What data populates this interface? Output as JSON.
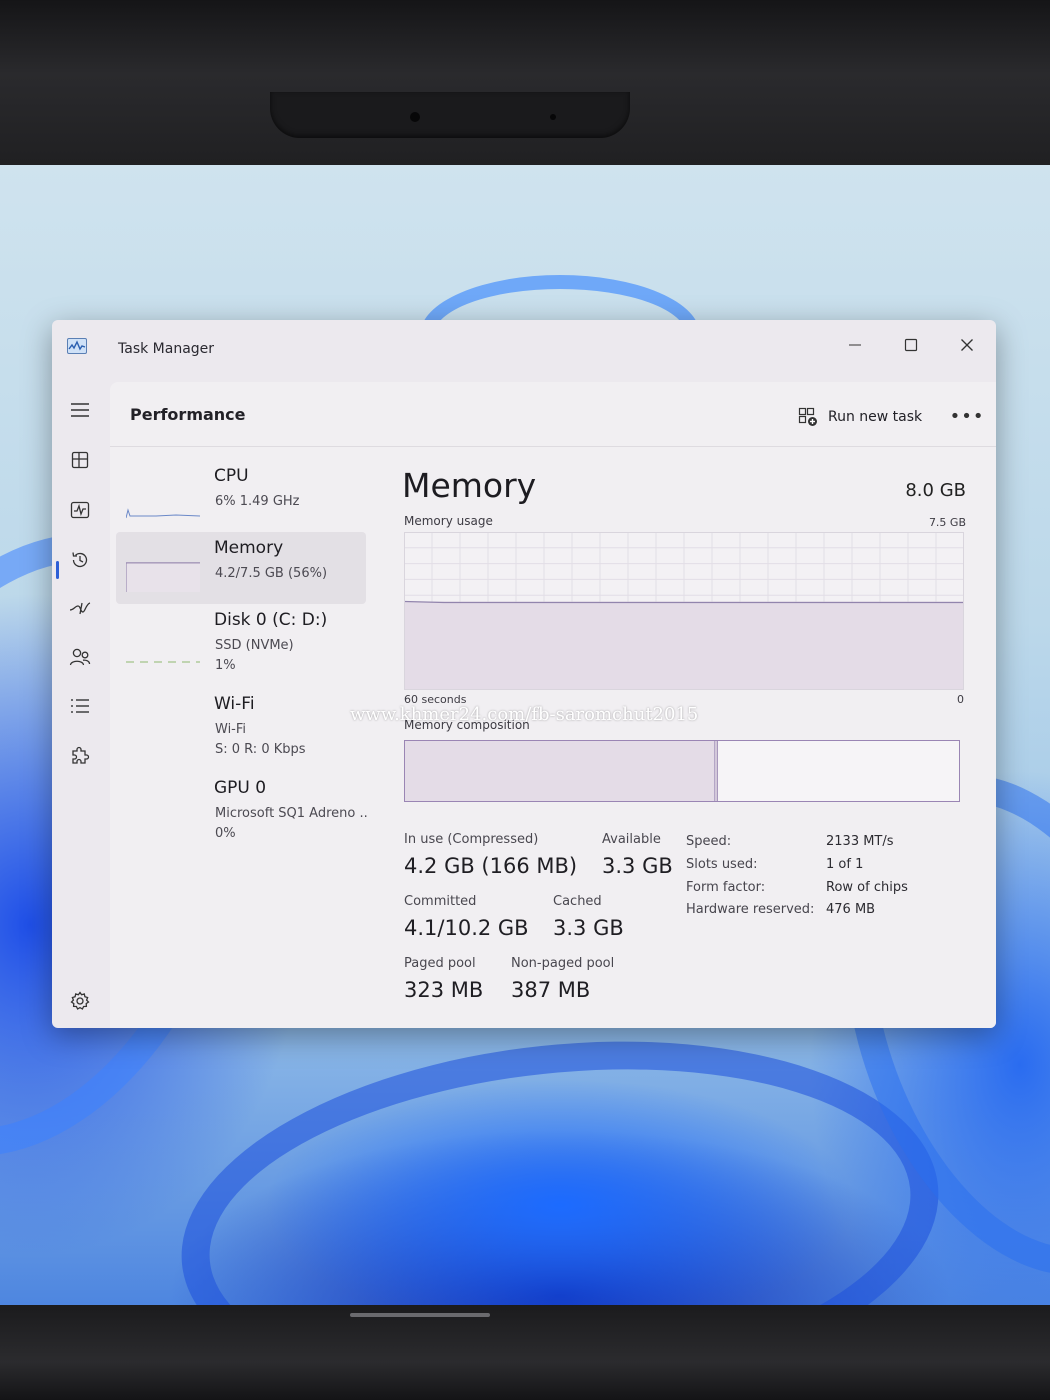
{
  "window": {
    "title": "Task Manager",
    "minimize_icon": "minimize-icon",
    "maximize_icon": "maximize-icon",
    "close_icon": "close-icon"
  },
  "sidebar": {
    "items": [
      {
        "name": "hamburger-menu",
        "icon": "hamburger-icon"
      },
      {
        "name": "processes",
        "icon": "processes-icon"
      },
      {
        "name": "performance",
        "icon": "performance-icon",
        "active": true
      },
      {
        "name": "app-history",
        "icon": "history-icon"
      },
      {
        "name": "startup-apps",
        "icon": "startup-icon"
      },
      {
        "name": "users",
        "icon": "users-icon"
      },
      {
        "name": "details",
        "icon": "list-icon"
      },
      {
        "name": "services",
        "icon": "puzzle-icon"
      },
      {
        "name": "settings",
        "icon": "gear-icon"
      }
    ]
  },
  "header": {
    "title": "Performance",
    "run_new_task": "Run new task",
    "more": "•••"
  },
  "devices": [
    {
      "name": "CPU",
      "line1": "6%  1.49 GHz",
      "line2": ""
    },
    {
      "name": "Memory",
      "line1": "4.2/7.5 GB (56%)",
      "line2": "",
      "selected": true
    },
    {
      "name": "Disk 0 (C: D:)",
      "line1": "SSD (NVMe)",
      "line2": "1%"
    },
    {
      "name": "Wi-Fi",
      "line1": "Wi-Fi",
      "line2": "S: 0 R: 0 Kbps"
    },
    {
      "name": "GPU 0",
      "line1": "Microsoft SQ1 Adreno ..",
      "line2": "0%"
    }
  ],
  "memory": {
    "title": "Memory",
    "total": "8.0 GB",
    "usage_label": "Memory usage",
    "usage_max": "7.5 GB",
    "axis_left": "60 seconds",
    "axis_right": "0",
    "usage_fraction": 0.56,
    "composition_label": "Memory composition",
    "composition": {
      "in_use_fraction": 0.56,
      "modified_fraction": 0.005
    },
    "stats": {
      "in_use_label": "In use (Compressed)",
      "in_use_value": "4.2 GB (166 MB)",
      "available_label": "Available",
      "available_value": "3.3 GB",
      "committed_label": "Committed",
      "committed_value": "4.1/10.2 GB",
      "cached_label": "Cached",
      "cached_value": "3.3 GB",
      "paged_label": "Paged pool",
      "paged_value": "323 MB",
      "nonpaged_label": "Non-paged pool",
      "nonpaged_value": "387 MB"
    },
    "specs": {
      "speed_key": "Speed:",
      "speed_val": "2133 MT/s",
      "slots_key": "Slots used:",
      "slots_val": "1 of 1",
      "form_key": "Form factor:",
      "form_val": "Row of chips",
      "reserved_key": "Hardware reserved:",
      "reserved_val": "476 MB"
    }
  },
  "watermark": "www.khmer24.com/fb-saromchut2015",
  "colors": {
    "accent": "#2e5fd6",
    "memory_fill": "#e4dce7",
    "memory_border": "#9a85b4"
  }
}
